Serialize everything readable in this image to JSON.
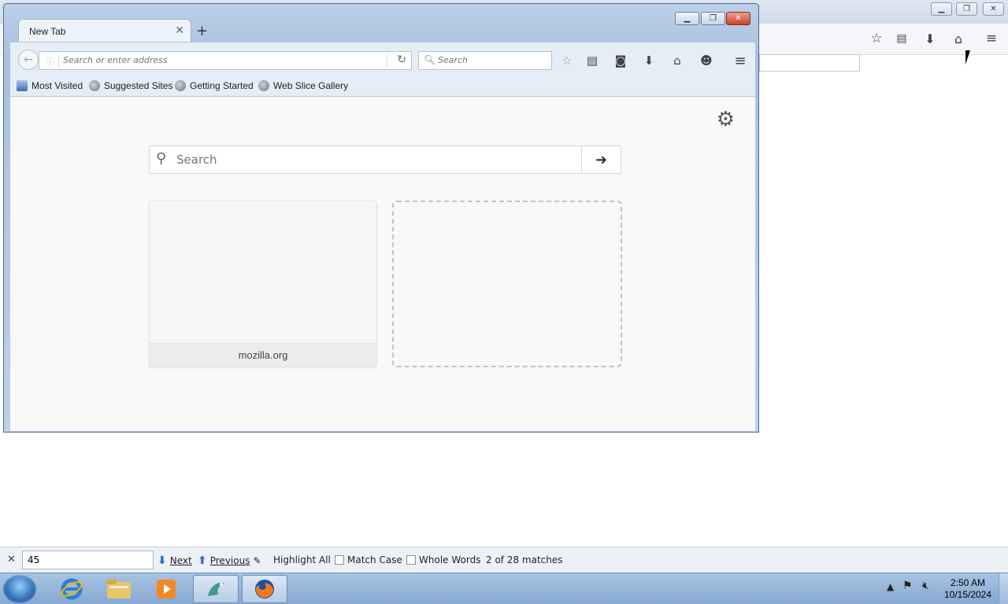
{
  "background_browser": {
    "toolbar_icons": [
      "star-icon",
      "reading-list-icon",
      "download-icon",
      "home-icon",
      "menu-icon"
    ]
  },
  "window": {
    "tab_title": "New Tab",
    "url_placeholder": "Search or enter address",
    "search_placeholder": "Search",
    "bookmarks": [
      {
        "label": "Most Visited"
      },
      {
        "label": "Suggested Sites"
      },
      {
        "label": "Getting Started"
      },
      {
        "label": "Web Slice Gallery"
      }
    ]
  },
  "newtab": {
    "search_placeholder": "Search",
    "tiles": [
      {
        "label": "mozilla.org"
      }
    ]
  },
  "findbar": {
    "value": "45",
    "next_label": "Next",
    "previous_label": "Previous",
    "highlight_all_label": "Highlight All",
    "match_case_label": "Match Case",
    "whole_words_label": "Whole Words",
    "match_status": "2 of 28 matches"
  },
  "taskbar": {
    "time": "2:50 AM",
    "date": "10/15/2024"
  },
  "colors": {
    "window_frame": "#a8c1df",
    "find_arrows": "#2d6fcf"
  }
}
